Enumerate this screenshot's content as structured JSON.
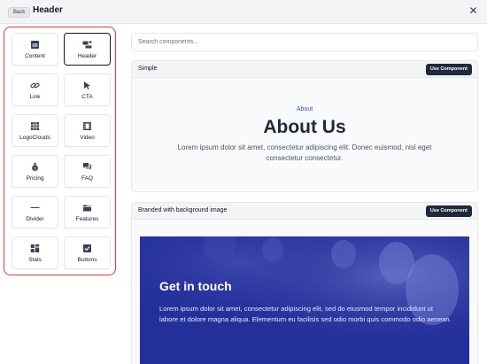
{
  "topbar": {
    "back_label": "Back",
    "title": "Header",
    "close_symbol": "✕"
  },
  "sidebar": {
    "items": [
      {
        "label": "Content",
        "icon": "content-icon"
      },
      {
        "label": "Header",
        "icon": "header-icon",
        "selected": true
      },
      {
        "label": "Link",
        "icon": "link-icon"
      },
      {
        "label": "CTA",
        "icon": "cursor-icon"
      },
      {
        "label": "LogoClouds",
        "icon": "grid-icon"
      },
      {
        "label": "Video",
        "icon": "film-icon"
      },
      {
        "label": "Pricing",
        "icon": "money-bag-icon"
      },
      {
        "label": "FAQ",
        "icon": "chat-icon"
      },
      {
        "label": "Divider",
        "icon": "divider-icon"
      },
      {
        "label": "Features",
        "icon": "folder-icon"
      },
      {
        "label": "Stats",
        "icon": "stats-icon"
      },
      {
        "label": "Buttons",
        "icon": "checkbox-icon"
      }
    ]
  },
  "search": {
    "placeholder": "Search components..."
  },
  "cards": [
    {
      "title": "Simple",
      "button_label": "Use Component",
      "preview": {
        "eyebrow": "About",
        "heading": "About Us",
        "text": "Lorem ipsum dolor sit amet, consectetur adipiscing elit. Donec euismod, nisl eget consectetur consectetur."
      }
    },
    {
      "title": "Branded with background image",
      "button_label": "Use Component",
      "preview": {
        "heading": "Get in touch",
        "text": "Lorem ipsum dolor sit amet, consectetur adipiscing elit, sed do eiusmod tempor incididunt ut labore et dolore magna aliqua. Elementum eu facilisis sed odio morbi quis commodo odio aenean."
      }
    }
  ],
  "colors": {
    "accent": "#e23a3a",
    "button_dark": "#1e293b",
    "hero_overlay": "#24309a",
    "eyebrow": "#3b4ba8"
  }
}
